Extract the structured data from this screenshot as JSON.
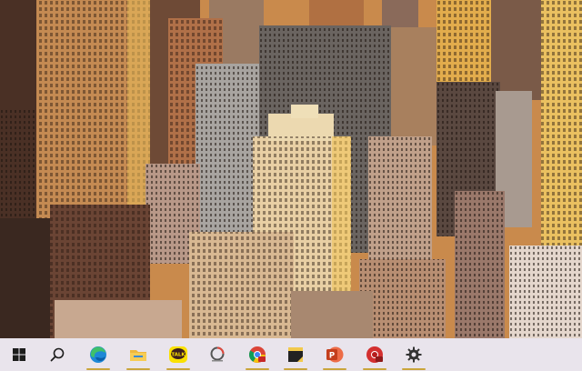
{
  "wallpaper": {
    "description_icon": "city-skyline-wallpaper"
  },
  "taskbar": {
    "background": "#e9e4ec",
    "items": [
      {
        "name": "start-button",
        "icon": "windows-logo-icon",
        "running": false
      },
      {
        "name": "search-button",
        "icon": "search-icon",
        "running": false
      },
      {
        "name": "edge-button",
        "icon": "edge-icon",
        "running": true
      },
      {
        "name": "file-explorer-button",
        "icon": "folder-icon",
        "running": true
      },
      {
        "name": "kakaotalk-button",
        "icon": "kakaotalk-icon",
        "label": "TALK",
        "running": true
      },
      {
        "name": "app-button",
        "icon": "app-icon",
        "running": false
      },
      {
        "name": "chrome-button",
        "icon": "chrome-icon",
        "running": true
      },
      {
        "name": "sticky-notes-button",
        "icon": "sticky-notes-icon",
        "running": true
      },
      {
        "name": "powerpoint-button",
        "icon": "powerpoint-icon",
        "label": "P",
        "running": true
      },
      {
        "name": "chrome-profile-button",
        "icon": "chrome-icon",
        "running": true
      },
      {
        "name": "settings-button",
        "icon": "gear-icon",
        "running": true
      }
    ],
    "running_indicator_color": "#caa53b"
  }
}
